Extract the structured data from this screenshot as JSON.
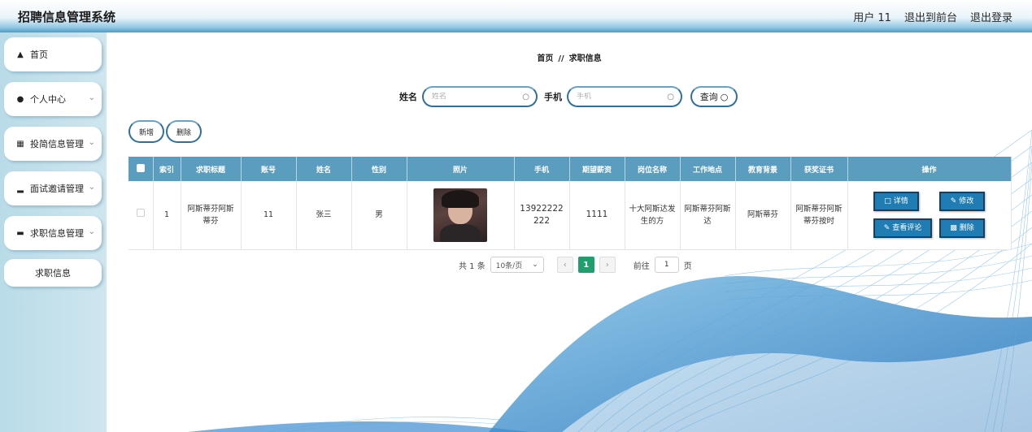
{
  "header": {
    "title": "招聘信息管理系统",
    "user": "用户 11",
    "front": "退出到前台",
    "logout": "退出登录"
  },
  "sidebar": {
    "items": [
      {
        "label": "首页",
        "icon": "home-icon"
      },
      {
        "label": "个人中心",
        "icon": "user-icon"
      },
      {
        "label": "投简信息管理",
        "icon": "grid-icon"
      },
      {
        "label": "面试邀请管理",
        "icon": "bar-chart-icon"
      },
      {
        "label": "求职信息管理",
        "icon": "monitor-icon"
      }
    ],
    "sub_item": "求职信息"
  },
  "breadcrumb": {
    "home": "首页",
    "separator": "//",
    "current": "求职信息"
  },
  "search": {
    "name_label": "姓名",
    "name_placeholder": "姓名",
    "phone_label": "手机",
    "phone_placeholder": "手机",
    "query_label": "查询"
  },
  "actions": {
    "add": "新增",
    "delete": "删除"
  },
  "table": {
    "headers": [
      "索引",
      "求职标题",
      "账号",
      "姓名",
      "性别",
      "照片",
      "手机",
      "期望薪资",
      "岗位名称",
      "工作地点",
      "教育背景",
      "获奖证书",
      "操作"
    ],
    "rows": [
      {
        "index": "1",
        "title": "阿斯蒂芬阿斯蒂芬",
        "account": "11",
        "name": "张三",
        "gender": "男",
        "phone": "13922222222",
        "salary": "1111",
        "position": "十大阿斯达发生的方",
        "location": "阿斯蒂芬阿斯达",
        "education": "阿斯蒂芬",
        "awards": "阿斯蒂芬阿斯蒂芬按时"
      }
    ],
    "ops": {
      "detail": "详情",
      "edit": "修改",
      "review": "查看评论",
      "delete": "删除"
    }
  },
  "pagination": {
    "total": "共 1 条",
    "page_size": "10条/页",
    "current": "1",
    "goto_prefix": "前往",
    "goto_value": "1",
    "goto_suffix": "页"
  },
  "colors": {
    "header_accent": "#4a9ccb",
    "table_header": "#5b9dbf",
    "op_button": "#1f7db3",
    "page_active": "#1f9e6e"
  }
}
